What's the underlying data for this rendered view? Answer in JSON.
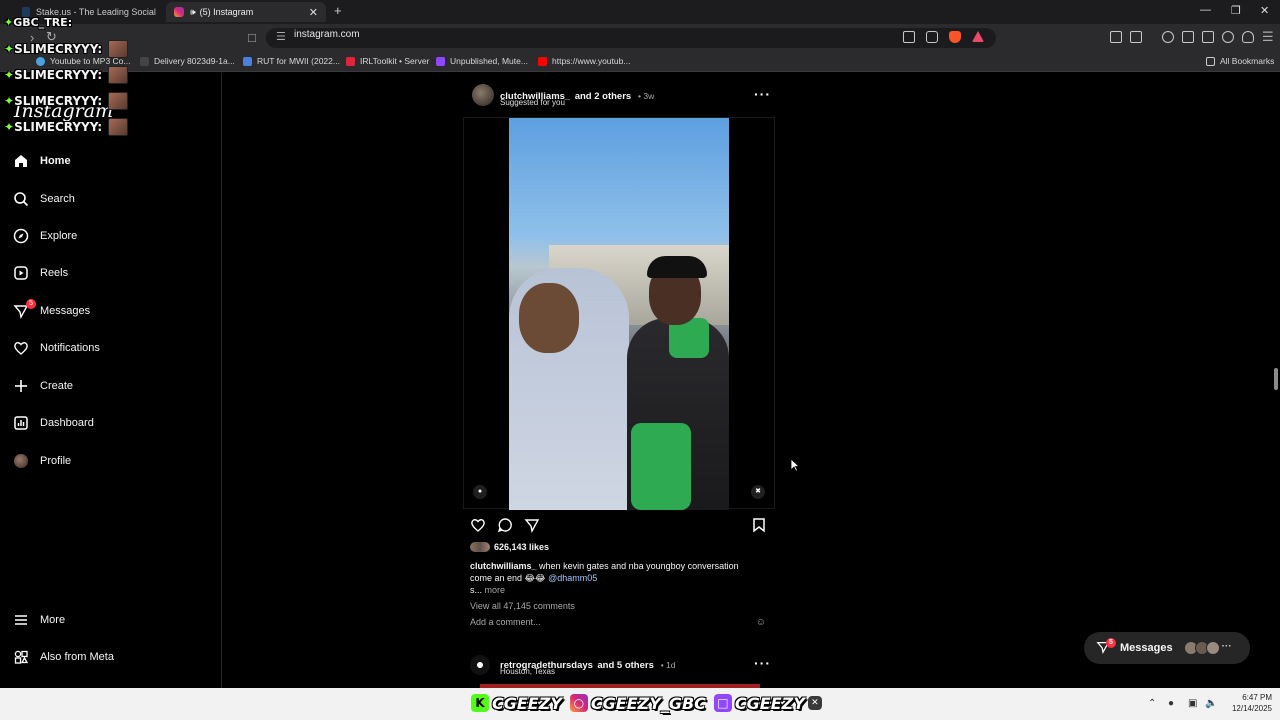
{
  "browser": {
    "tabs": [
      {
        "title": "Stake.us - The Leading Social Casino"
      },
      {
        "title": "(5) Instagram"
      }
    ],
    "url": "instagram.com",
    "bookmarks": [
      "Youtube to MP3 Co...",
      "Delivery 8023d9-1a...",
      "RUT for MWII (2022...",
      "IRLToolkit • Server",
      "Unpublished, Mute...",
      "https://www.youtub..."
    ],
    "all_bookmarks": "All Bookmarks"
  },
  "overlay": {
    "chat_top": "GBC_TRE:",
    "chat_lines": [
      "SLIMECRYYY:",
      "SLIMECRYYY:",
      "SLIMECRYYY:",
      "SLIMECRYYY:"
    ]
  },
  "instagram": {
    "logo": "Instagram",
    "nav": [
      {
        "label": "Home",
        "icon": "home-icon"
      },
      {
        "label": "Search",
        "icon": "search-icon"
      },
      {
        "label": "Explore",
        "icon": "compass-icon"
      },
      {
        "label": "Reels",
        "icon": "reels-icon"
      },
      {
        "label": "Messages",
        "icon": "messenger-icon"
      },
      {
        "label": "Notifications",
        "icon": "heart-icon"
      },
      {
        "label": "Create",
        "icon": "plus-icon"
      },
      {
        "label": "Dashboard",
        "icon": "dashboard-icon"
      },
      {
        "label": "Profile",
        "icon": "avatar-icon"
      }
    ],
    "messages_badge": "5",
    "bottom_nav": [
      {
        "label": "More",
        "icon": "menu-icon"
      },
      {
        "label": "Also from Meta",
        "icon": "meta-icon"
      }
    ],
    "post": {
      "author": "clutchwilliams_",
      "coauthors": "and 2 others",
      "age": "3w",
      "subtitle": "Suggested for you",
      "likes": "626,143 likes",
      "caption_user": "clutchwilliams_",
      "caption_text": "when kevin gates and nba youngboy conversation come an end 😂😂",
      "caption_mention": "@dhamm05",
      "caption_rest": "s...",
      "more": "more",
      "comments": "View all 47,145 comments",
      "add_comment": "Add a comment..."
    },
    "post2": {
      "author": "retrogradethursdays",
      "coauthors": "and 5 others",
      "age": "1d",
      "location": "Houston, Texas"
    },
    "messages_pill": {
      "label": "Messages",
      "badge": "5"
    }
  },
  "taskbar": {
    "banner": [
      "CGEEZY",
      "CGEEZY_GBC",
      "CGEEZY"
    ],
    "time": "6:47 PM",
    "date": "12/14/2025"
  },
  "colors": {
    "accent_red": "#ff3040",
    "link": "#a6c8ff",
    "green_star": "#7bff3a"
  }
}
